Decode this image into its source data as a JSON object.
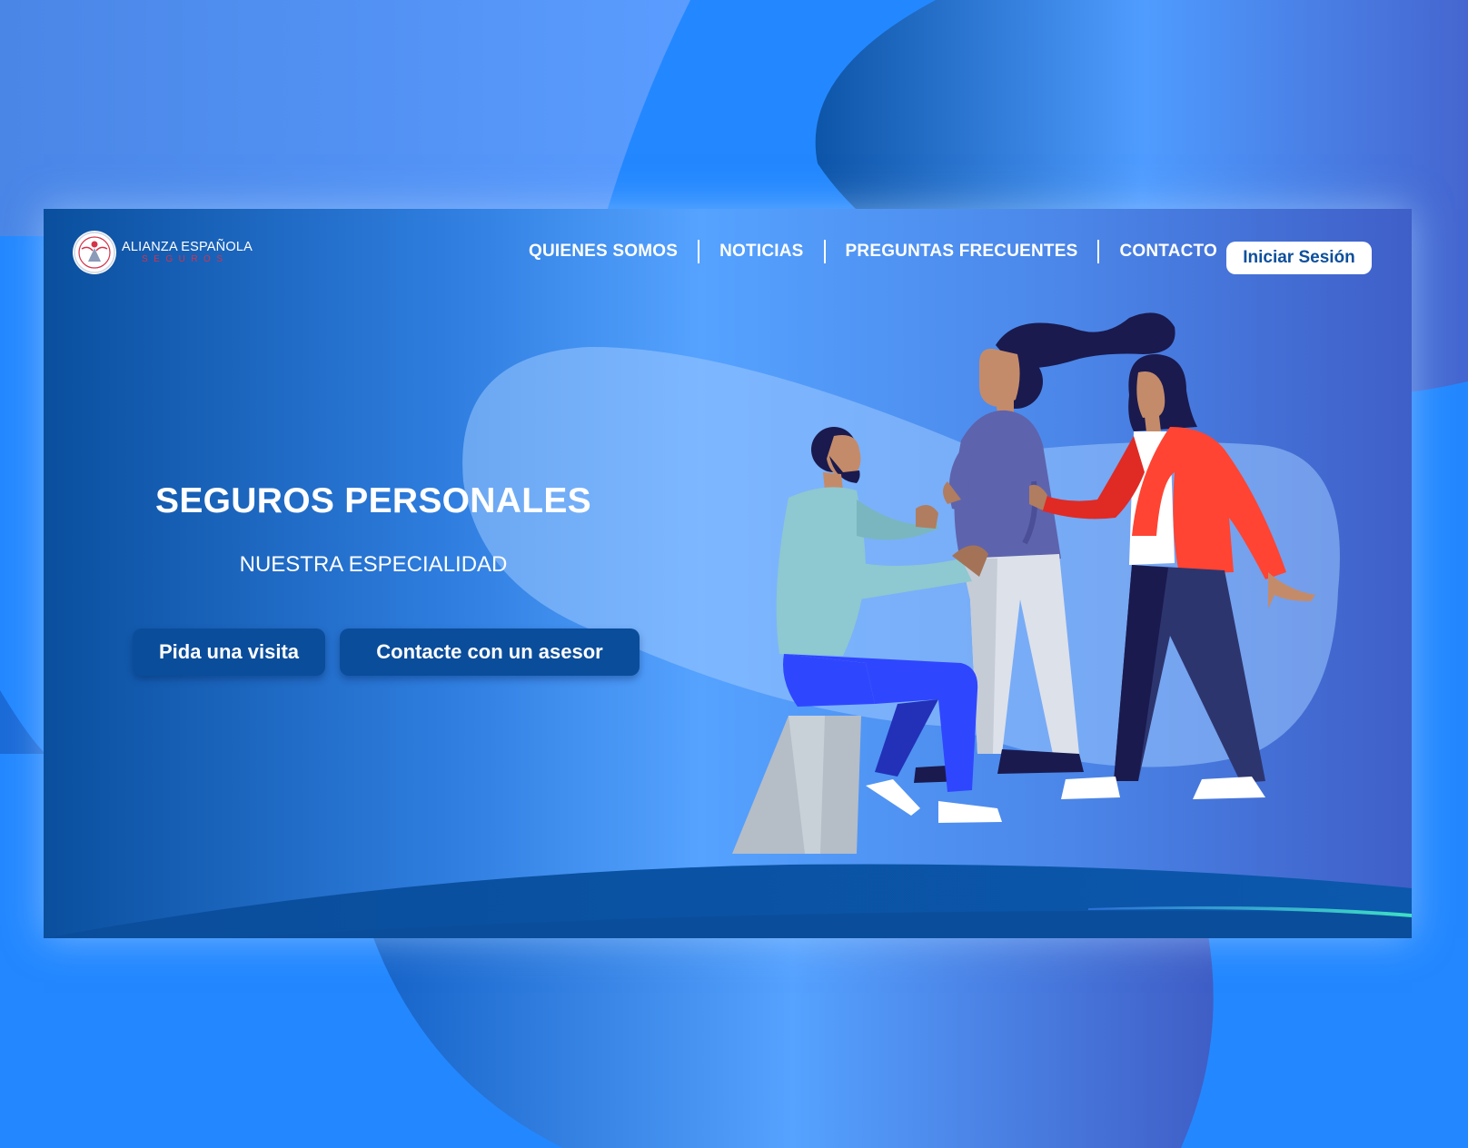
{
  "brand": {
    "name": "ALIANZA ESPAÑOLA",
    "subtitle": "SEGUROS",
    "logo_icon": "angel-emblem-icon"
  },
  "nav": {
    "items": [
      {
        "label": "QUIENES SOMOS"
      },
      {
        "label": "NOTICIAS"
      },
      {
        "label": "PREGUNTAS FRECUENTES"
      },
      {
        "label": "CONTACTO"
      }
    ],
    "login_label": "Iniciar Sesión"
  },
  "hero": {
    "title": "SEGUROS PERSONALES",
    "subtitle": "NUESTRA ESPECIALIDAD",
    "primary_button": "Pida una visita",
    "secondary_button": "Contacte con un asesor",
    "illustration": "people-consultation-illustration"
  },
  "colors": {
    "page_background": "#2287ff",
    "card_dark": "#0a4f9e",
    "card_light": "#55a2ff",
    "button": "#0a4d9b",
    "login_text": "#0d4f9c",
    "accent_red": "#d4334a",
    "wave_teal": "#3ee0c4"
  }
}
